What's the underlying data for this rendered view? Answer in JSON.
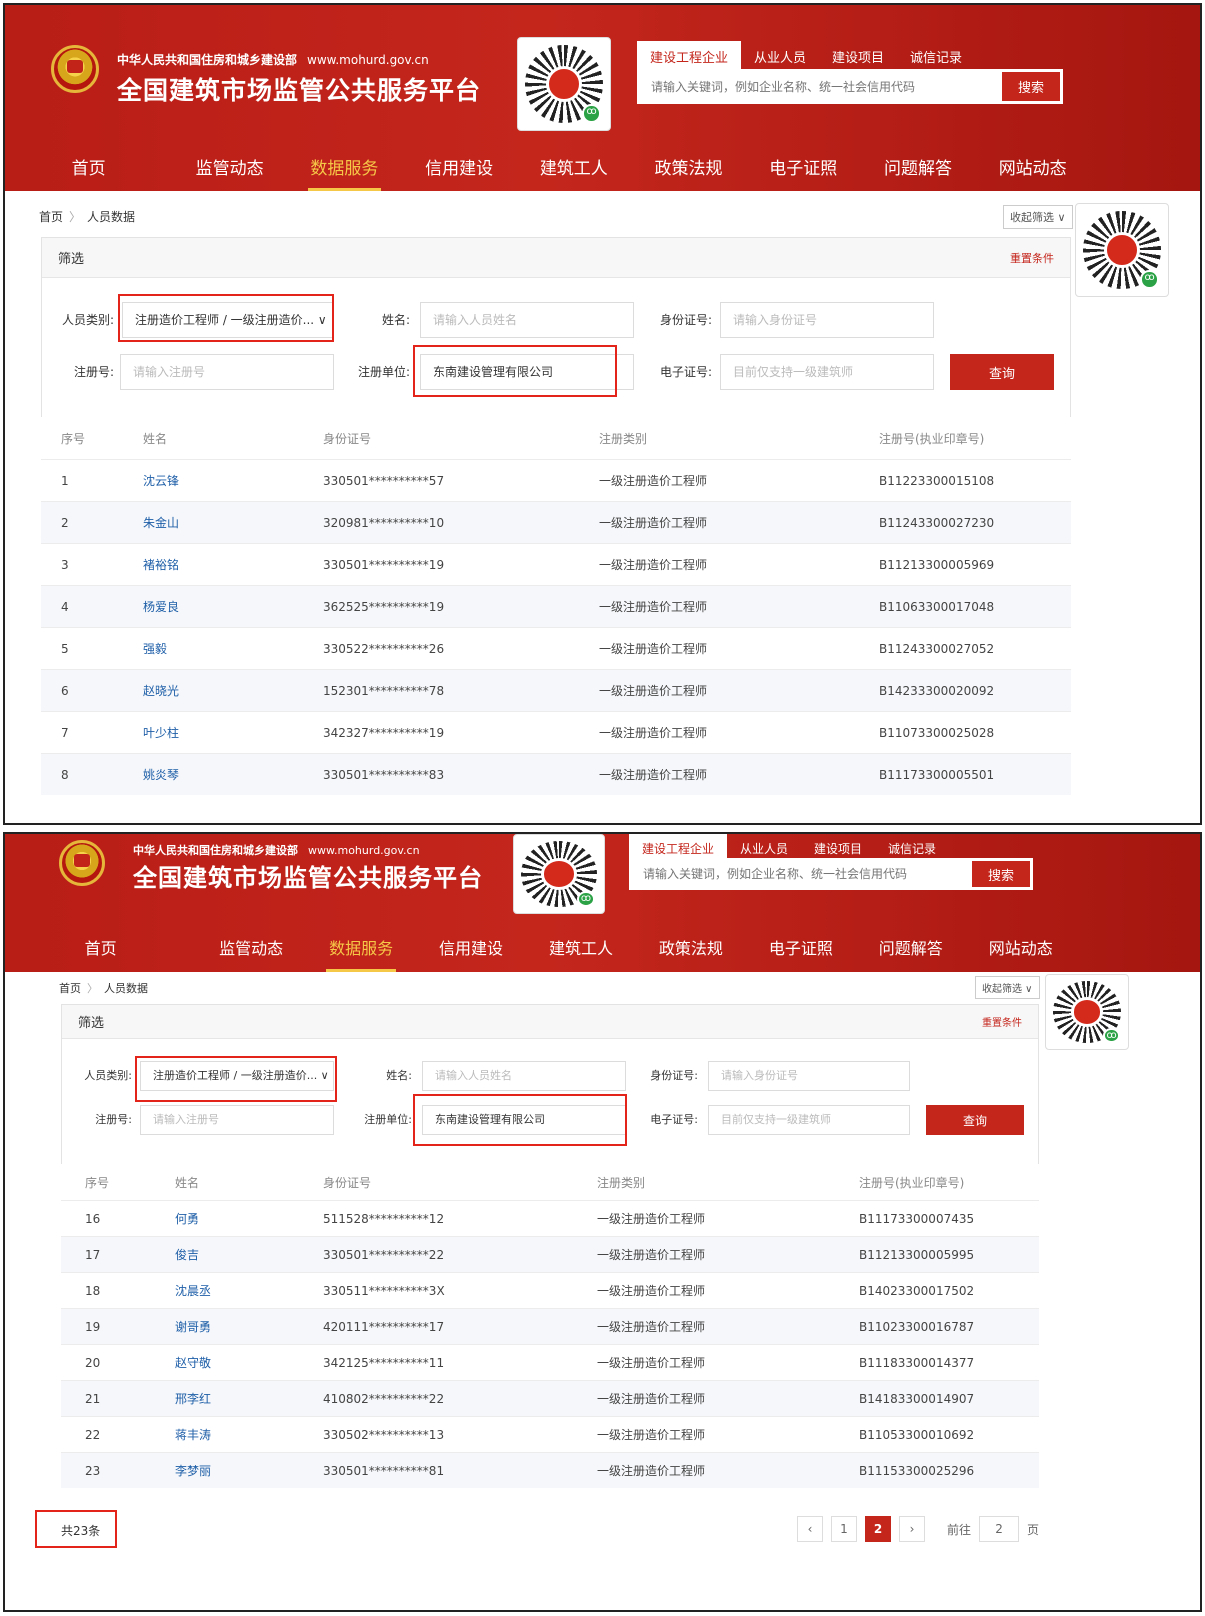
{
  "header": {
    "ministry": "中华人民共和国住房和城乡建设部",
    "url": "www.mohurd.gov.cn",
    "platform": "全国建筑市场监管公共服务平台",
    "search_tabs": [
      "建设工程企业",
      "从业人员",
      "建设项目",
      "诚信记录"
    ],
    "search_placeholder": "请输入关键词，例如企业名称、统一社会信用代码",
    "search_button": "搜索"
  },
  "nav": [
    "首页",
    "监管动态",
    "数据服务",
    "信用建设",
    "建筑工人",
    "政策法规",
    "电子证照",
    "问题解答",
    "网站动态"
  ],
  "nav_active_index": 2,
  "breadcrumb": {
    "home": "首页",
    "sep": "〉",
    "current": "人员数据"
  },
  "collapse_label": "收起筛选 ∨",
  "filter": {
    "title": "筛选",
    "reset": "重置条件",
    "category_label": "人员类别:",
    "category_value": "注册造价工程师 / 一级注册造价... ∨",
    "name_label": "姓名:",
    "name_placeholder": "请输入人员姓名",
    "id_label": "身份证号:",
    "id_placeholder": "请输入身份证号",
    "regno_label": "注册号:",
    "regno_placeholder": "请输入注册号",
    "unit_label": "注册单位:",
    "unit_value": "东南建设管理有限公司",
    "cert_label": "电子证号:",
    "cert_placeholder": "目前仅支持一级建筑师",
    "query_button": "查询"
  },
  "table": {
    "headers": [
      "序号",
      "姓名",
      "身份证号",
      "注册类别",
      "注册号(执业印章号)"
    ],
    "page1_rows": [
      [
        "1",
        "沈云锋",
        "330501**********57",
        "一级注册造价工程师",
        "B11223300015108"
      ],
      [
        "2",
        "朱金山",
        "320981**********10",
        "一级注册造价工程师",
        "B11243300027230"
      ],
      [
        "3",
        "褚裕铭",
        "330501**********19",
        "一级注册造价工程师",
        "B11213300005969"
      ],
      [
        "4",
        "杨爱良",
        "362525**********19",
        "一级注册造价工程师",
        "B11063300017048"
      ],
      [
        "5",
        "强毅",
        "330522**********26",
        "一级注册造价工程师",
        "B11243300027052"
      ],
      [
        "6",
        "赵晓光",
        "152301**********78",
        "一级注册造价工程师",
        "B14233300020092"
      ],
      [
        "7",
        "叶少柱",
        "342327**********19",
        "一级注册造价工程师",
        "B11073300025028"
      ],
      [
        "8",
        "姚炎琴",
        "330501**********83",
        "一级注册造价工程师",
        "B11173300005501"
      ]
    ],
    "page2_rows": [
      [
        "16",
        "何勇",
        "511528**********12",
        "一级注册造价工程师",
        "B11173300007435"
      ],
      [
        "17",
        "俊吉",
        "330501**********22",
        "一级注册造价工程师",
        "B11213300005995"
      ],
      [
        "18",
        "沈晨丞",
        "330511**********3X",
        "一级注册造价工程师",
        "B14023300017502"
      ],
      [
        "19",
        "谢哥勇",
        "420111**********17",
        "一级注册造价工程师",
        "B11023300016787"
      ],
      [
        "20",
        "赵守敬",
        "342125**********11",
        "一级注册造价工程师",
        "B11183300014377"
      ],
      [
        "21",
        "邢李红",
        "410802**********22",
        "一级注册造价工程师",
        "B14183300014907"
      ],
      [
        "22",
        "蒋丰涛",
        "330502**********13",
        "一级注册造价工程师",
        "B11053300010692"
      ],
      [
        "23",
        "李梦丽",
        "330501**********81",
        "一级注册造价工程师",
        "B11153300025296"
      ]
    ]
  },
  "pagination": {
    "total": "共23条",
    "prev": "‹",
    "pages": [
      "1",
      "2"
    ],
    "current_page": "2",
    "next": "›",
    "goto_label": "前往",
    "goto_value": "2",
    "page_suffix": "页"
  }
}
